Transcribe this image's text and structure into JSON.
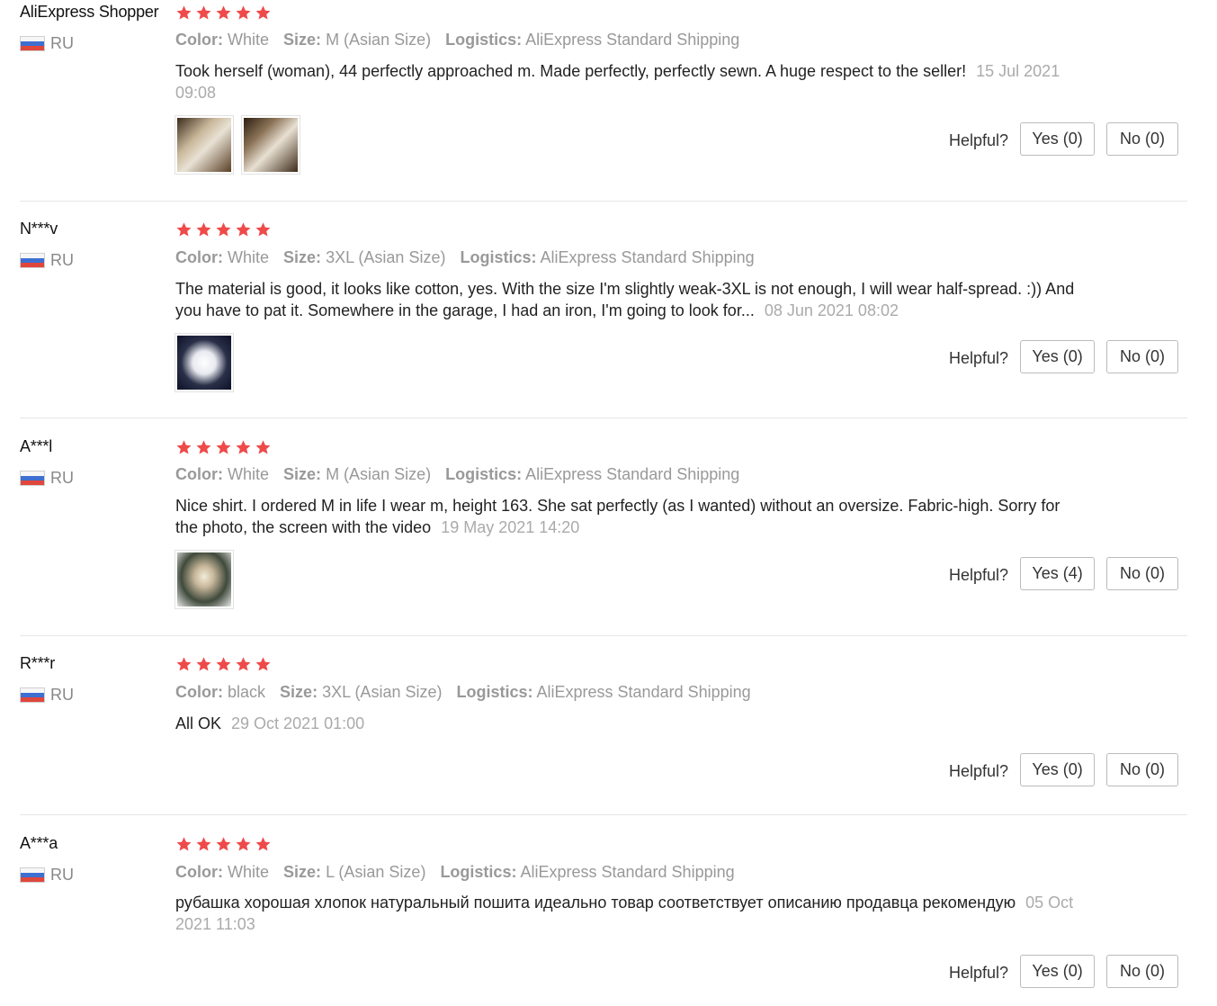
{
  "labels": {
    "color": "Color:",
    "size": "Size:",
    "logistics": "Logistics:",
    "helpful": "Helpful?"
  },
  "colors": {
    "star": "#ef4a4a",
    "flag": [
      "#f6f6f6",
      "#3e6fd1",
      "#e0473c"
    ]
  },
  "reviews": [
    {
      "user": "AliExpress Shopper",
      "country": "RU",
      "rating": 5,
      "color": "White",
      "size": "M (Asian Size)",
      "logistics": "AliExpress Standard Shipping",
      "text": "Took herself (woman), 44 perfectly approached m. Made perfectly, perfectly sewn. A huge respect to the seller!",
      "date": "15 Jul 2021 09:08",
      "photos": [
        "review-photo",
        "review-photo"
      ],
      "yes": "Yes (0)",
      "no": "No (0)"
    },
    {
      "user": "N***v",
      "country": "RU",
      "rating": 5,
      "color": "White",
      "size": "3XL (Asian Size)",
      "logistics": "AliExpress Standard Shipping",
      "text": "The material is good, it looks like cotton, yes. With the size I'm slightly weak-3XL is not enough, I will wear half-spread. :)) And you have to pat it. Somewhere in the garage, I had an iron, I'm going to look for...",
      "date": "08 Jun 2021 08:02",
      "photos": [
        "review-photo"
      ],
      "yes": "Yes (0)",
      "no": "No (0)"
    },
    {
      "user": "A***l",
      "country": "RU",
      "rating": 5,
      "color": "White",
      "size": "M (Asian Size)",
      "logistics": "AliExpress Standard Shipping",
      "text": "Nice shirt. I ordered M in life I wear m, height 163. She sat perfectly (as I wanted) without an oversize. Fabric-high. Sorry for the photo, the screen with the video",
      "date": "19 May 2021 14:20",
      "photos": [
        "review-photo"
      ],
      "yes": "Yes (4)",
      "no": "No (0)"
    },
    {
      "user": "R***r",
      "country": "RU",
      "rating": 5,
      "color": "black",
      "size": "3XL (Asian Size)",
      "logistics": "AliExpress Standard Shipping",
      "text": "All OK",
      "date": "29 Oct 2021 01:00",
      "photos": [],
      "yes": "Yes (0)",
      "no": "No (0)"
    },
    {
      "user": "A***a",
      "country": "RU",
      "rating": 5,
      "color": "White",
      "size": "L (Asian Size)",
      "logistics": "AliExpress Standard Shipping",
      "text": "рубашка хорошая хлопок натуральный пошита идеально товар соответствует описанию продавца рекомендую",
      "date": "05 Oct 2021 11:03",
      "photos": [],
      "yes": "Yes (0)",
      "no": "No (0)"
    }
  ]
}
